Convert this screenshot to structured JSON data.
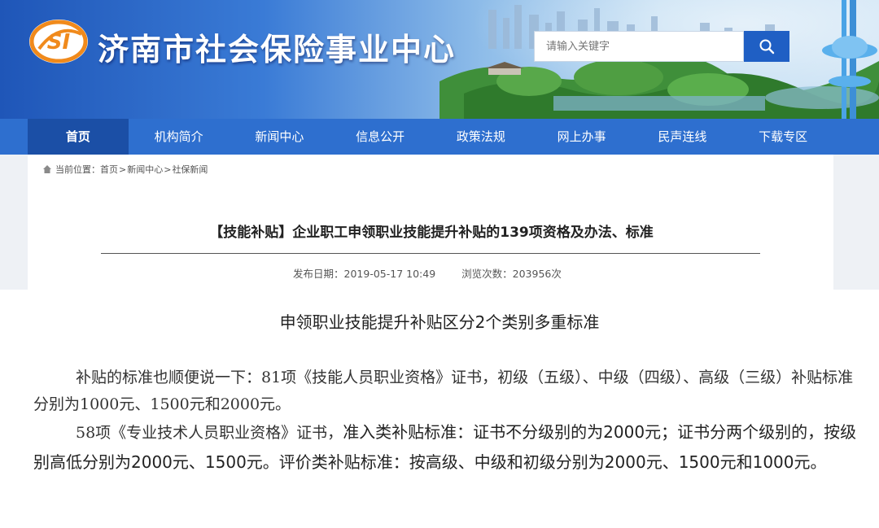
{
  "header": {
    "site_title": "济南市社会保险事业中心",
    "logo_text": "SI",
    "search": {
      "placeholder": "请输入关键字",
      "icon": "search-icon"
    }
  },
  "nav": {
    "items": [
      {
        "label": "首页",
        "active": true
      },
      {
        "label": "机构简介"
      },
      {
        "label": "新闻中心"
      },
      {
        "label": "信息公开"
      },
      {
        "label": "政策法规"
      },
      {
        "label": "网上办事"
      },
      {
        "label": "民声连线"
      },
      {
        "label": "下载专区"
      }
    ]
  },
  "breadcrumb": {
    "prefix": "当前位置：",
    "items": [
      "首页",
      "新闻中心",
      "社保新闻"
    ],
    "separator": ">"
  },
  "article": {
    "title": "【技能补贴】企业职工申领职业技能提升补贴的139项资格及办法、标准",
    "publish_label": "发布日期：",
    "publish_date": "2019-05-17 10:49",
    "views_label": "浏览次数：",
    "views": "203956次",
    "subheading": "申领职业技能提升补贴区分2个类别多重标准",
    "paragraph1": "补贴的标准也顺便说一下：81项《技能人员职业资格》证书，初级（五级）、中级（四级）、高级（三级）补贴标准分别为1000元、1500元和2000元。",
    "paragraph2_lead": "58项《专业技术人员职业资格》证书，",
    "paragraph2_rest": "准入类补贴标准：证书不分级别的为2000元；证书分两个级别的，按级别高低分别为2000元、1500元。评价类补贴标准：按高级、中级和初级分别为2000元、1500元和1000元。"
  },
  "colors": {
    "nav_bg": "#2e6fcf",
    "nav_active": "#1b4fa6",
    "logo_orange": "#f08a1c",
    "search_btn": "#1f5fc4"
  }
}
